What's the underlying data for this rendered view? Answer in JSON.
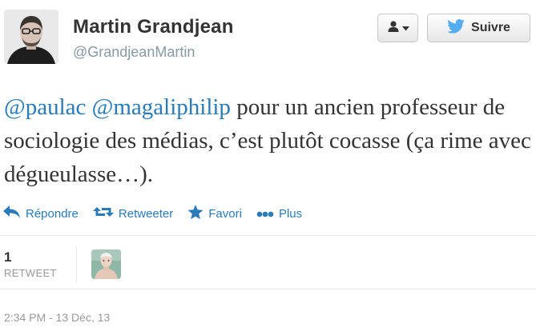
{
  "user": {
    "display_name": "Martin Grandjean",
    "screen_name": "@GrandjeanMartin"
  },
  "buttons": {
    "follow_label": "Suivre"
  },
  "tweet": {
    "mention1": "@paulac",
    "mention2": "@magaliphilip",
    "body": " pour un ancien professeur de sociologie des médias, c’est plutôt cocasse (ça rime avec dégueulasse…)."
  },
  "actions": {
    "reply": "Répondre",
    "retweet": "Retweeter",
    "favorite": "Favori",
    "more": "Plus"
  },
  "stats": {
    "retweet_count": "1",
    "retweet_label": "RETWEET"
  },
  "timestamp": "2:34 PM - 13 Déc, 13",
  "icons": {
    "user_dropdown": "person-icon",
    "follow": "twitter-bird-icon",
    "reply": "reply-arrow-icon",
    "retweet": "retweet-icon",
    "favorite": "star-icon",
    "more": "more-dots-icon"
  },
  "colors": {
    "link": "#2b7bb9",
    "muted": "#8899a6",
    "twitter_blue": "#55acee"
  }
}
